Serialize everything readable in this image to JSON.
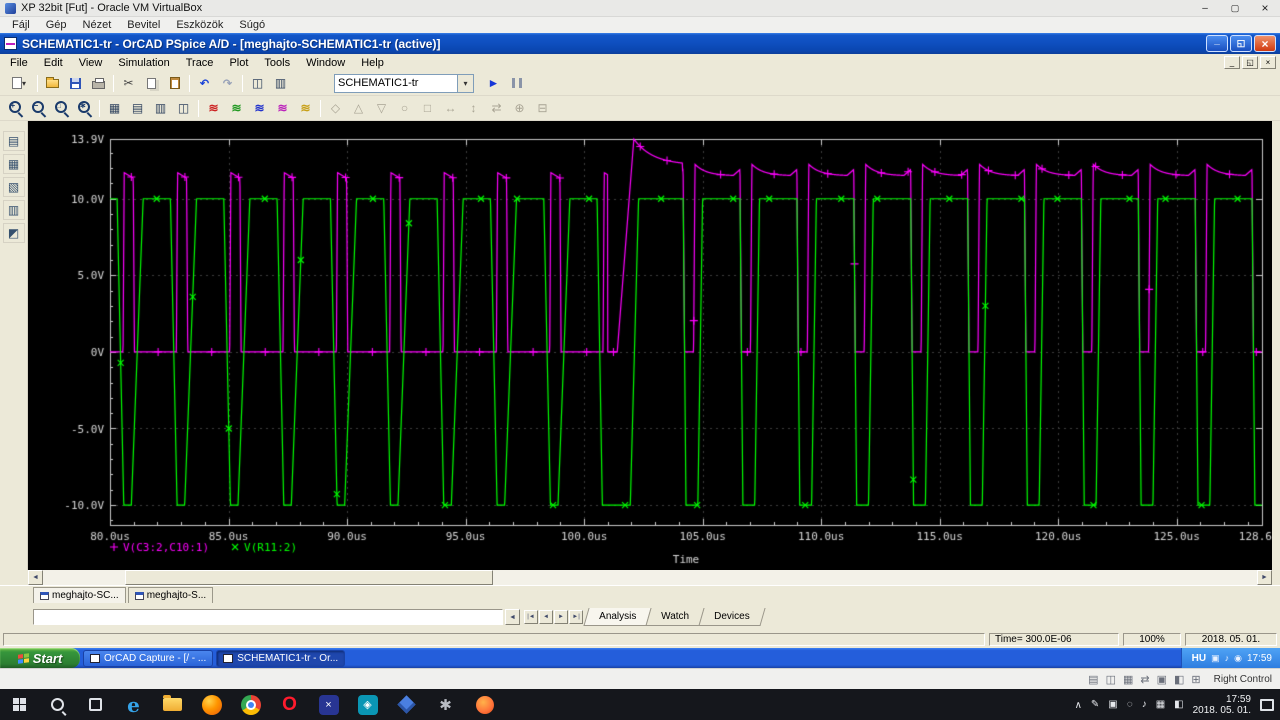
{
  "vbox": {
    "title": "XP 32bit [Fut] - Oracle VM VirtualBox",
    "menu": [
      "Fájl",
      "Gép",
      "Nézet",
      "Bevitel",
      "Eszközök",
      "Súgó"
    ],
    "status_hint": "Right Control"
  },
  "pspice": {
    "title": "SCHEMATIC1-tr - OrCAD PSpice A/D  - [meghajto-SCHEMATIC1-tr (active)]",
    "menu": [
      "File",
      "Edit",
      "View",
      "Simulation",
      "Trace",
      "Plot",
      "Tools",
      "Window",
      "Help"
    ],
    "simulation_profile": "SCHEMATIC1-tr",
    "doc_tabs": [
      "meghajto-SC...",
      "meghajto-S..."
    ],
    "output_tabs": [
      "Analysis",
      "Watch",
      "Devices"
    ],
    "status_time": "Time= 300.0E-06",
    "status_zoom": "100%",
    "status_date": "2018. 05. 01."
  },
  "xp_taskbar": {
    "start": "Start",
    "tasks": [
      "OrCAD Capture - [/ - ...",
      "SCHEMATIC1-tr - Or..."
    ],
    "language": "HU",
    "time": "17:59"
  },
  "host_taskbar": {
    "time": "17:59",
    "date": "2018. 05. 01."
  },
  "chart_data": {
    "type": "line",
    "title": "",
    "xlabel": "Time",
    "ylabel": "",
    "xlim": [
      80,
      128.6
    ],
    "ylim": [
      -11.3,
      13.9
    ],
    "grid": true,
    "background": "#000000",
    "legend_position": "bottom-left",
    "x_ticks": {
      "values": [
        80,
        85,
        90,
        95,
        100,
        105,
        110,
        115,
        120,
        125,
        128.6
      ],
      "labels": [
        "80.0us",
        "85.0us",
        "90.0us",
        "95.0us",
        "100.0us",
        "105.0us",
        "110.0us",
        "115.0us",
        "120.0us",
        "125.0us",
        "128.6us"
      ]
    },
    "y_ticks": {
      "values": [
        13.9,
        10,
        5,
        0,
        -5,
        -10
      ],
      "labels": [
        "13.9V",
        "10.0V",
        "5.0V",
        "0V",
        "-5.0V",
        "-10.0V"
      ]
    },
    "series": [
      {
        "name": "V(C3:2,C10:1)",
        "color": "#ff00ff",
        "marker": "+",
        "marker_interval": 1.13,
        "marker_t0": 80.9,
        "waveform": {
          "kind": "gate-pulse",
          "narrow": {
            "t0": 80.55,
            "t_end": 101.0,
            "period": 2.25,
            "edge": 0.05,
            "width": 0.38,
            "amp": 11.7
          },
          "surge": {
            "t_rise": 101.4,
            "peak_t": 102.1,
            "peak_v": 13.9,
            "settle_v": 12.2,
            "tau": 0.8,
            "t_end": 104.15
          },
          "wide": {
            "t0": 104.62,
            "period": 2.4,
            "edge": 0.06,
            "high": 1.9,
            "amp0": 12.25,
            "amp1": 11.5
          }
        }
      },
      {
        "name": "V(R11:2)",
        "color": "#00ff00",
        "marker": "x",
        "marker_interval": 1.52,
        "marker_t0": 80.45,
        "waveform": {
          "kind": "drain-pulse",
          "baseline": 10,
          "low": -10,
          "narrow": {
            "t0": 80.3,
            "t_end": 100.5,
            "period": 2.25,
            "fall": 0.28,
            "hold": 0.32,
            "rise": 0.5
          },
          "gap": {
            "t_fall": 100.55,
            "fall": 0.22,
            "t_rise": 101.95,
            "rise": 0.35
          },
          "late": {
            "t0": 104.18,
            "period": 2.4,
            "fall": 0.12,
            "hold": 0.5,
            "rise": 0.2
          }
        }
      }
    ]
  }
}
